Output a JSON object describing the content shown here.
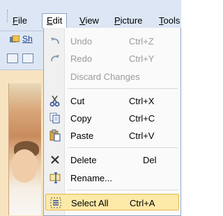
{
  "menubar": {
    "items": [
      {
        "key": "F",
        "rest": "ile"
      },
      {
        "key": "E",
        "rest": "dit"
      },
      {
        "key": "V",
        "rest": "iew"
      },
      {
        "key": "P",
        "rest": "icture"
      },
      {
        "key": "T",
        "rest": "ools"
      }
    ]
  },
  "toolbar": {
    "share_label": "Sh"
  },
  "edit_menu": {
    "undo": {
      "label": "Undo",
      "shortcut": "Ctrl+Z"
    },
    "redo": {
      "label": "Redo",
      "shortcut": "Ctrl+Y"
    },
    "discard": {
      "label": "Discard Changes"
    },
    "cut": {
      "label": "Cut",
      "shortcut": "Ctrl+X"
    },
    "copy": {
      "label": "Copy",
      "shortcut": "Ctrl+C"
    },
    "paste": {
      "label": "Paste",
      "shortcut": "Ctrl+V"
    },
    "delete": {
      "label": "Delete",
      "shortcut": "Del"
    },
    "rename": {
      "label": "Rename..."
    },
    "select_all": {
      "label": "Select All",
      "shortcut": "Ctrl+A"
    }
  },
  "colors": {
    "menubar_bg": "#dce6f4",
    "highlight_bg": "#fde9a8",
    "highlight_border": "#e3b94b",
    "disabled_text": "#9a9a9a"
  }
}
